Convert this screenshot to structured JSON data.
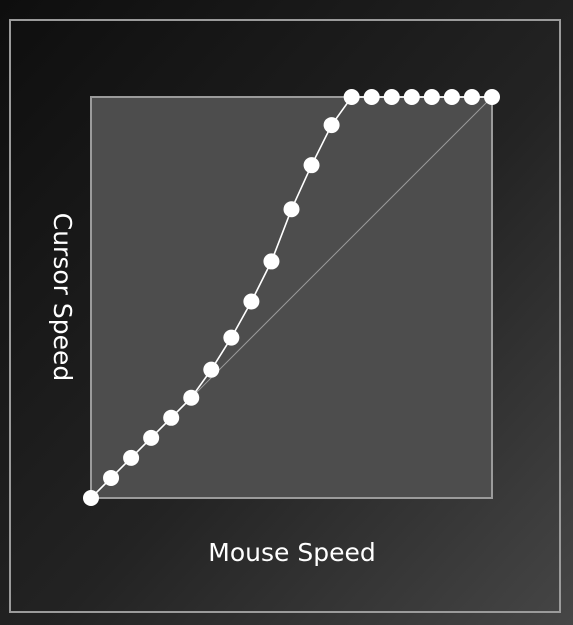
{
  "chart_data": {
    "type": "scatter",
    "title": "",
    "xlabel": "Mouse Speed",
    "ylabel": "Cursor Speed",
    "xlim": [
      0,
      1
    ],
    "ylim": [
      0,
      1
    ],
    "grid": false,
    "legend": "none",
    "series": [
      {
        "x": [
          0.0,
          0.05,
          0.1,
          0.15,
          0.2,
          0.25,
          0.3,
          0.35,
          0.4,
          0.45,
          0.5,
          0.55,
          0.6,
          0.65,
          0.7,
          0.75,
          0.8,
          0.85,
          0.9,
          0.95,
          1.0
        ],
        "y": [
          0.0,
          0.05,
          0.1,
          0.15,
          0.2,
          0.25,
          0.32,
          0.4,
          0.49,
          0.59,
          0.72,
          0.83,
          0.93,
          1.0,
          1.0,
          1.0,
          1.0,
          1.0,
          1.0,
          1.0,
          1.0
        ]
      }
    ],
    "reference_line": {
      "x": [
        0,
        1
      ],
      "y": [
        0,
        1
      ]
    }
  },
  "colors": {
    "background_dark": "#121212",
    "background_light": "#3c3c3c",
    "plot_fill": "#4d4d4d",
    "frame_stroke": "#9b9b9b",
    "point_fill": "#ffffff",
    "line_color": "#ffffff",
    "reference_line_color": "#9a9a9a"
  }
}
